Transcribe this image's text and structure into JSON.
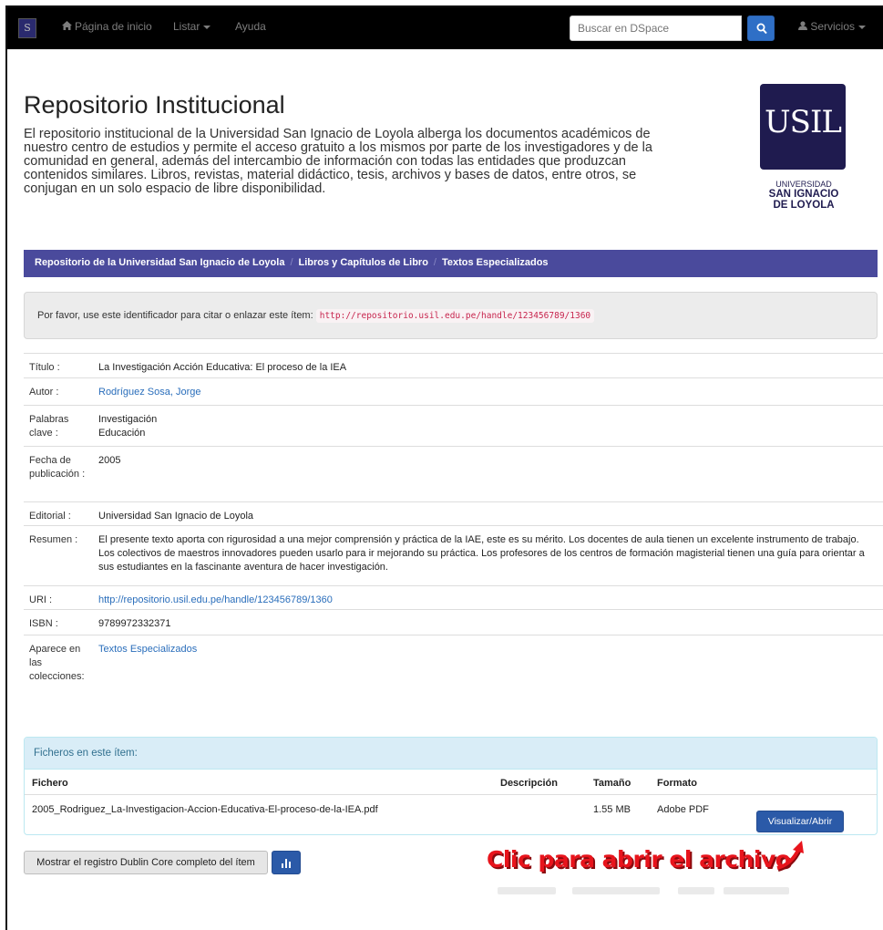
{
  "navbar": {
    "logo_letter": "S",
    "home_label": "Página de inicio",
    "listar_label": "Listar",
    "ayuda_label": "Ayuda",
    "search_placeholder": "Buscar en DSpace",
    "servicios_label": "Servicios"
  },
  "header": {
    "title": "Repositorio Institucional",
    "description": "El repositorio institucional de la Universidad San Ignacio de Loyola alberga los documentos académicos de nuestro centro de estudios y permite el acceso gratuito a los mismos por parte de los investigadores y de la comunidad en general, además del intercambio de información con todas las entidades que produzcan contenidos similares. Libros, revistas, material didáctico, tesis, archivos y bases de datos, entre otros, se conjugan en un solo espacio de libre disponibilidad.",
    "logo": {
      "mark": "USIL",
      "line1": "UNIVERSIDAD",
      "line2": "SAN IGNACIO",
      "line3": "DE LOYOLA"
    }
  },
  "breadcrumb": [
    "Repositorio de la Universidad San Ignacio de Loyola",
    "Libros y Capítulos de Libro",
    "Textos Especializados"
  ],
  "identifier": {
    "text": "Por favor, use este identificador para citar o enlazar este ítem:",
    "url": "http://repositorio.usil.edu.pe/handle/123456789/1360"
  },
  "metadata": {
    "titulo_label": "Título :",
    "titulo": "La Investigación Acción Educativa: El proceso de la IEA",
    "autor_label": "Autor :",
    "autor": "Rodríguez Sosa, Jorge",
    "palabras_label": "Palabras clave :",
    "palabras": [
      "Investigación",
      "Educación"
    ],
    "fecha_label": "Fecha de publicación :",
    "fecha": "2005",
    "editorial_label": "Editorial :",
    "editorial": "Universidad San Ignacio de Loyola",
    "resumen_label": "Resumen :",
    "resumen": "El presente texto aporta con rigurosidad a una mejor comprensión y práctica de la IAE, este es su mérito. Los docentes de aula tienen un excelente instrumento de trabajo. Los colectivos de maestros innovadores pueden usarlo para ir mejorando su práctica. Los profesores de los centros de formación magisterial tienen una guía para orientar a sus estudiantes en la fascinante aventura de hacer investigación.",
    "uri_label": "URI :",
    "uri": "http://repositorio.usil.edu.pe/handle/123456789/1360",
    "isbn_label": "ISBN :",
    "isbn": "9789972332371",
    "colecciones_label": "Aparece en las colecciones:",
    "colecciones": "Textos Especializados"
  },
  "files": {
    "panel_title": "Ficheros en este ítem:",
    "headers": [
      "Fichero",
      "Descripción",
      "Tamaño",
      "Formato"
    ],
    "rows": [
      {
        "name": "2005_Rodriguez_La-Investigacion-Accion-Educativa-El-proceso-de-la-IEA.pdf",
        "description": "",
        "size": "1.55 MB",
        "format": "Adobe PDF",
        "action": "Visualizar/Abrir"
      }
    ]
  },
  "dublin_core_button": "Mostrar el registro Dublin Core completo del ítem",
  "annotation": "Clic para abrir el archivo",
  "colors": {
    "navbar": "#000000",
    "breadcrumb": "#4a4a9c",
    "primary_button": "#2b5aa8",
    "link": "#2a6ebb",
    "annotation": "#e8141c",
    "logo_bg": "#1f1b4f"
  }
}
